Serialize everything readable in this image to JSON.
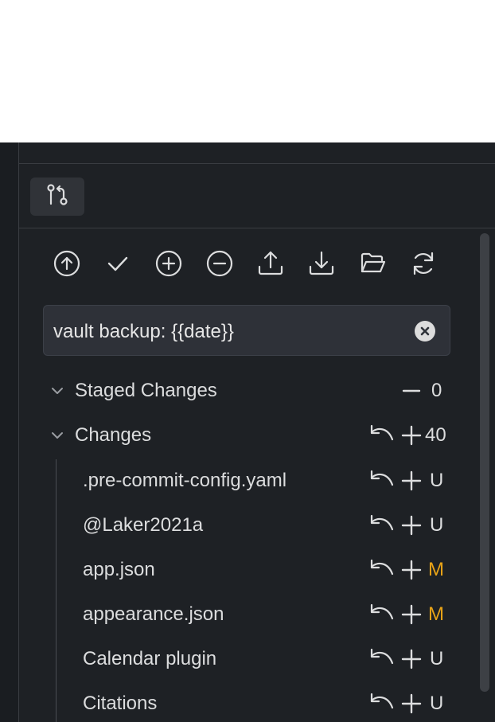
{
  "colors": {
    "accent_modified": "#e8a317",
    "text": "#dcddde",
    "background": "#1e2125"
  },
  "view_tab": {
    "icon": "git-pull-request-icon"
  },
  "toolbar": [
    {
      "name": "push-button",
      "icon": "arrow-up-circle-icon"
    },
    {
      "name": "commit-button",
      "icon": "check-icon"
    },
    {
      "name": "stage-all-button",
      "icon": "plus-circle-icon"
    },
    {
      "name": "unstage-all-button",
      "icon": "minus-circle-icon"
    },
    {
      "name": "upload-button",
      "icon": "upload-icon"
    },
    {
      "name": "pull-button",
      "icon": "download-icon"
    },
    {
      "name": "open-folder-button",
      "icon": "folder-open-icon"
    },
    {
      "name": "refresh-button",
      "icon": "refresh-icon"
    }
  ],
  "commit_message": {
    "value": "vault backup: {{date}}"
  },
  "staged": {
    "label": "Staged Changes",
    "count": "0"
  },
  "changes": {
    "label": "Changes",
    "count": "40",
    "files": [
      {
        "name": ".pre-commit-config.yaml",
        "status": "U"
      },
      {
        "name": "@Laker2021a",
        "status": "U"
      },
      {
        "name": "app.json",
        "status": "M"
      },
      {
        "name": "appearance.json",
        "status": "M"
      },
      {
        "name": "Calendar plugin",
        "status": "U"
      },
      {
        "name": "Citations",
        "status": "U"
      }
    ]
  }
}
